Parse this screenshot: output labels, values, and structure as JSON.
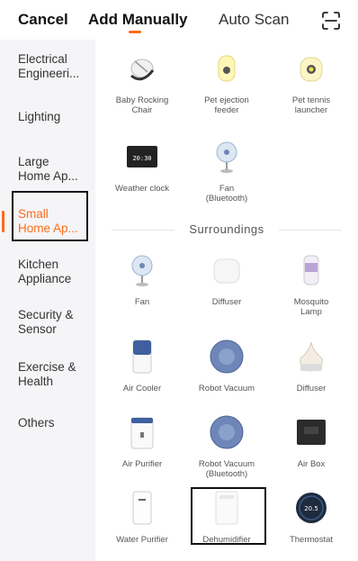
{
  "header": {
    "cancel_label": "Cancel",
    "tab_manual": "Add Manually",
    "tab_auto": "Auto Scan",
    "scan_icon": "scan-icon",
    "accent_color": "#ff6a1a"
  },
  "sidebar": {
    "items": [
      {
        "label": "Electrical\nEngineeri..."
      },
      {
        "label": "Lighting"
      },
      {
        "label": "Large\nHome Ap..."
      },
      {
        "label": "Small\nHome Ap..."
      },
      {
        "label": "Kitchen\nAppliance"
      },
      {
        "label": "Security &\nSensor"
      },
      {
        "label": "Exercise &\nHealth"
      },
      {
        "label": "Others"
      }
    ],
    "active_index": 3
  },
  "content": {
    "section_title": "Surroundings",
    "devices": [
      {
        "label": "Baby Rocking\nChair",
        "icon": "baby-rocking-chair-icon"
      },
      {
        "label": "Pet ejection\nfeeder",
        "icon": "pet-feeder-icon"
      },
      {
        "label": "Pet tennis\nlauncher",
        "icon": "tennis-launcher-icon"
      },
      {
        "label": "Weather clock",
        "icon": "weather-clock-icon"
      },
      {
        "label": "Fan\n(Bluetooth)",
        "icon": "fan-icon"
      },
      {
        "label": "Fan",
        "icon": "fan-icon"
      },
      {
        "label": "Diffuser",
        "icon": "diffuser-icon"
      },
      {
        "label": "Mosquito\nLamp",
        "icon": "mosquito-lamp-icon"
      },
      {
        "label": "Air Cooler",
        "icon": "air-cooler-icon"
      },
      {
        "label": "Robot Vacuum",
        "icon": "robot-vacuum-icon"
      },
      {
        "label": "Diffuser",
        "icon": "diffuser-icon"
      },
      {
        "label": "Air Purifier",
        "icon": "air-purifier-icon"
      },
      {
        "label": "Robot Vacuum\n(Bluetooth)",
        "icon": "robot-vacuum-icon"
      },
      {
        "label": "Air Box",
        "icon": "air-box-icon"
      },
      {
        "label": "Water Purifier",
        "icon": "water-purifier-icon"
      },
      {
        "label": "Dehumidifier",
        "icon": "dehumidifier-icon"
      },
      {
        "label": "Thermostat",
        "icon": "thermostat-icon"
      }
    ],
    "weather_clock_time": "20:30",
    "thermostat_value": "20.5"
  }
}
